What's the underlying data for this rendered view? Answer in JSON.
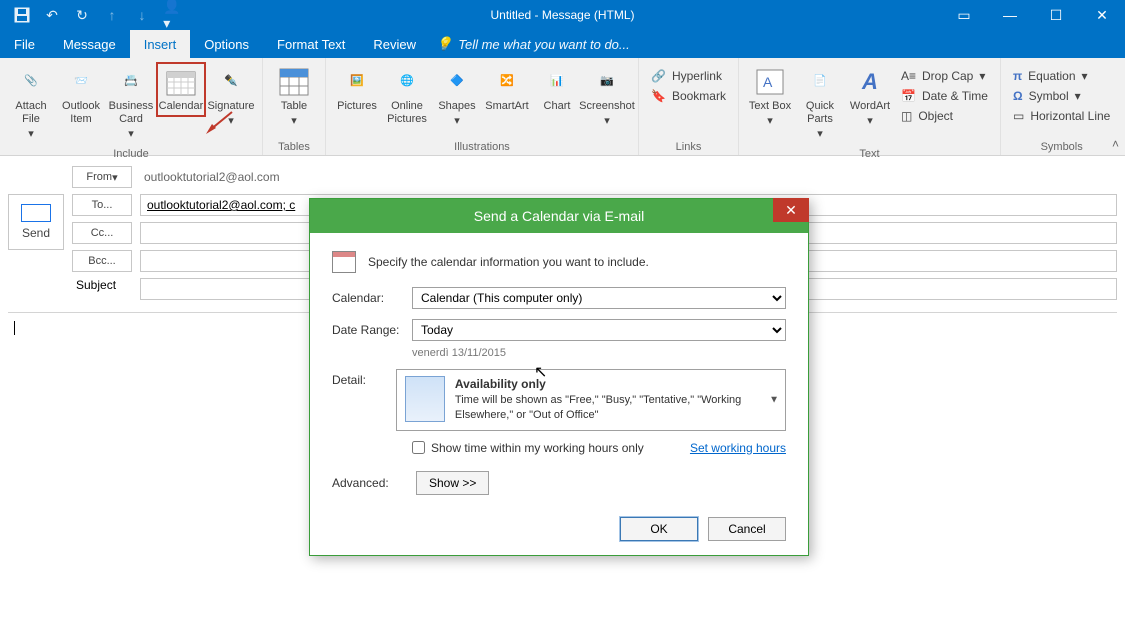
{
  "window": {
    "title": "Untitled - Message (HTML)"
  },
  "menu": {
    "file": "File",
    "message": "Message",
    "insert": "Insert",
    "options": "Options",
    "format": "Format Text",
    "review": "Review",
    "tellme": "Tell me what you want to do..."
  },
  "ribbon": {
    "include": {
      "attach_file": "Attach File",
      "outlook_item": "Outlook Item",
      "business_card": "Business Card",
      "calendar": "Calendar",
      "signature": "Signature",
      "group": "Include"
    },
    "tables": {
      "table": "Table",
      "group": "Tables"
    },
    "illustrations": {
      "pictures": "Pictures",
      "online_pictures": "Online Pictures",
      "shapes": "Shapes",
      "smartart": "SmartArt",
      "chart": "Chart",
      "screenshot": "Screenshot",
      "group": "Illustrations"
    },
    "links": {
      "hyperlink": "Hyperlink",
      "bookmark": "Bookmark",
      "group": "Links"
    },
    "text": {
      "text_box": "Text Box",
      "quick_parts": "Quick Parts",
      "wordart": "WordArt",
      "drop_cap": "Drop Cap",
      "date_time": "Date & Time",
      "object": "Object",
      "group": "Text"
    },
    "symbols": {
      "equation": "Equation",
      "symbol": "Symbol",
      "horizontal_line": "Horizontal Line",
      "group": "Symbols"
    }
  },
  "compose": {
    "send": "Send",
    "from": "From",
    "from_value": "outlooktutorial2@aol.com",
    "to": "To...",
    "to_value": "outlooktutorial2@aol.com; c",
    "cc": "Cc...",
    "bcc": "Bcc...",
    "subject": "Subject"
  },
  "dialog": {
    "title": "Send a Calendar via E-mail",
    "instruction": "Specify the calendar information you want to include.",
    "calendar_label": "Calendar:",
    "calendar_value": "Calendar (This computer only)",
    "daterange_label": "Date Range:",
    "daterange_value": "Today",
    "date_note": "venerdì 13/11/2015",
    "detail_label": "Detail:",
    "detail_title": "Availability only",
    "detail_desc": "Time will be shown as \"Free,\" \"Busy,\" \"Tentative,\" \"Working Elsewhere,\" or \"Out of Office\"",
    "show_time_chk": "Show time within my working hours only",
    "set_working": "Set working hours",
    "advanced_label": "Advanced:",
    "show_btn": "Show >>",
    "ok": "OK",
    "cancel": "Cancel"
  }
}
